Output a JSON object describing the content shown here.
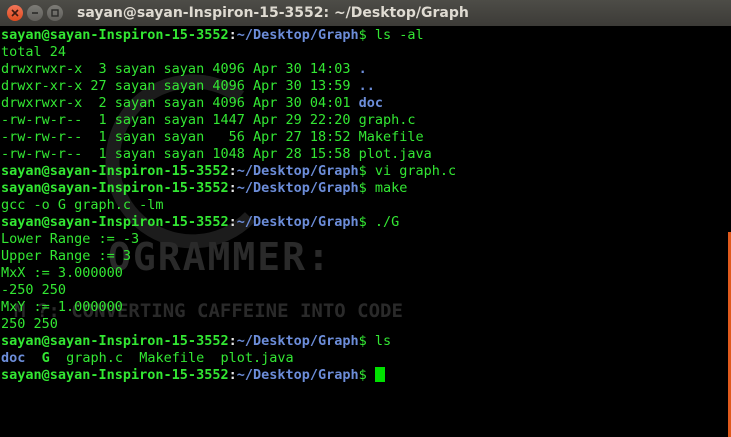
{
  "window": {
    "title": "sayan@sayan-Inspiron-15-3552: ~/Desktop/Graph"
  },
  "wallpaper": {
    "watermark_title": "OGRAMMER:",
    "watermark_tagline": "M   ?: CONVERTING CAFFEINE INTO CODE"
  },
  "terminal": {
    "user_host": "sayan@sayan-Inspiron-15-3552",
    "colon": ":",
    "path": "~/Desktop/Graph",
    "prompt_symbol": "$ ",
    "commands": {
      "ls_al": "ls -al",
      "vi": "vi graph.c",
      "make": "make",
      "run": "./G",
      "ls": "ls"
    },
    "ls_al_output": [
      {
        "text": "total 24"
      },
      {
        "text": "drwxrwxr-x  3 sayan sayan 4096 Apr 30 14:03 ",
        "name": "."
      },
      {
        "text": "drwxr-xr-x 27 sayan sayan 4096 Apr 30 13:59 ",
        "name": ".."
      },
      {
        "text": "drwxrwxr-x  2 sayan sayan 4096 Apr 30 04:01 ",
        "name": "doc"
      },
      {
        "text": "-rw-rw-r--  1 sayan sayan 1447 Apr 29 22:20 ",
        "name": "graph.c"
      },
      {
        "text": "-rw-rw-r--  1 sayan sayan   56 Apr 27 18:52 ",
        "name": "Makefile"
      },
      {
        "text": "-rw-rw-r--  1 sayan sayan 1048 Apr 28 15:58 ",
        "name": "plot.java"
      }
    ],
    "make_output": "gcc -o G graph.c -lm",
    "program_output": [
      "Lower Range := -3",
      "Upper Range := 3",
      "MxX := 3.000000",
      "-250 250",
      "MxY := 1.000000",
      "250 250"
    ],
    "ls_output": {
      "doc": "doc",
      "G": "G",
      "rest": "graph.c  Makefile  plot.java"
    }
  },
  "colors": {
    "text_green": "#33e733",
    "path_blue": "#6c8dd9",
    "cursor": "#00e000",
    "scroll_accent": "#e05a1d"
  }
}
